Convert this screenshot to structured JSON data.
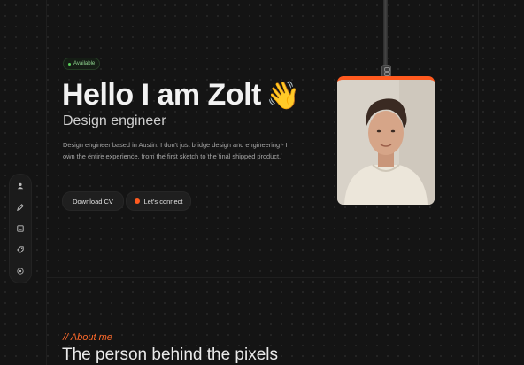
{
  "hero": {
    "status": "Available",
    "name": "Hello I am Zolt",
    "wave_emoji": "👋",
    "role": "Design engineer",
    "description": "Design engineer based in Austin. I don't just bridge design and engineering - I own the entire experience, from the first sketch to the final shipped product.",
    "cv_label": "Download CV",
    "connect_label": "Let's connect"
  },
  "sidebar": {
    "items": [
      {
        "icon": "user-icon"
      },
      {
        "icon": "pen-icon"
      },
      {
        "icon": "image-icon"
      },
      {
        "icon": "tag-icon"
      },
      {
        "icon": "settings-icon"
      }
    ]
  },
  "about": {
    "tag": "// About me",
    "title": "The person behind the pixels"
  },
  "colors": {
    "accent": "#ff5a1f",
    "status": "#5bd25b",
    "background": "#141414"
  }
}
